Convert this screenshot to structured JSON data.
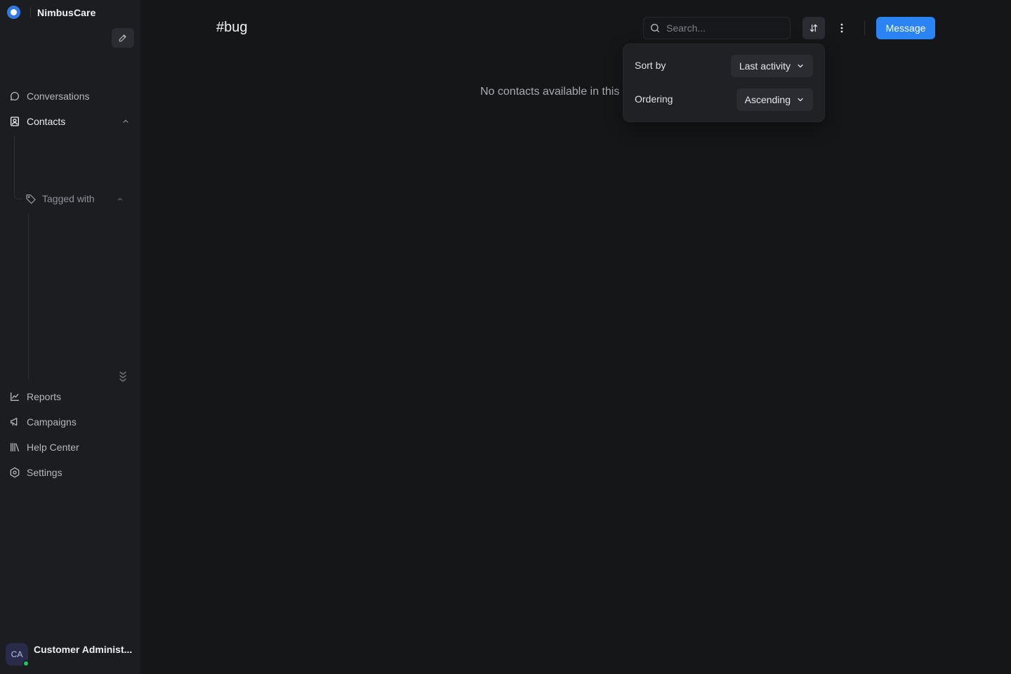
{
  "app": {
    "name": "NimbusCare"
  },
  "sidebar": {
    "items": [
      {
        "label": "Conversations",
        "icon": "chat-bubble-icon"
      },
      {
        "label": "Contacts",
        "icon": "contacts-icon"
      },
      {
        "label": "Reports",
        "icon": "line-chart-icon"
      },
      {
        "label": "Campaigns",
        "icon": "megaphone-icon"
      },
      {
        "label": "Help Center",
        "icon": "library-icon"
      },
      {
        "label": "Settings",
        "icon": "gear-icon"
      }
    ],
    "tagged_label": "Tagged with"
  },
  "profile": {
    "initials": "CA",
    "name": "Customer Administ...",
    "status": "online"
  },
  "main": {
    "title": "#bug",
    "search_placeholder": "Search...",
    "message_label": "Message",
    "empty_text": "No contacts available in this"
  },
  "sort_popover": {
    "sort_by_label": "Sort by",
    "sort_by_value": "Last activity",
    "ordering_label": "Ordering",
    "ordering_value": "Ascending"
  },
  "colors": {
    "accent": "#2b84f3",
    "sidebar_bg": "#1c1d20",
    "main_bg": "#151618",
    "online": "#22c55e"
  }
}
